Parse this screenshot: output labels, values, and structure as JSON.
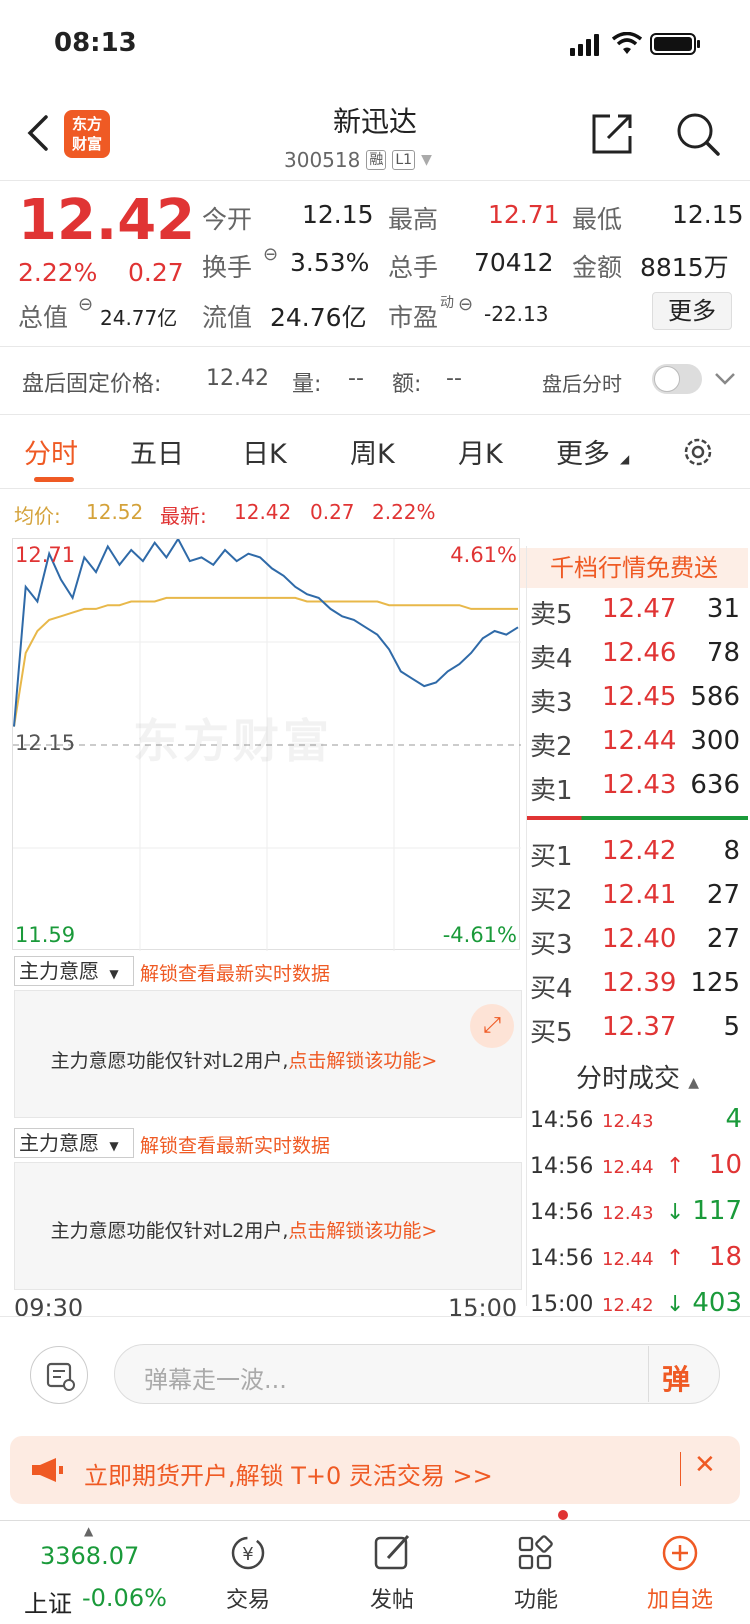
{
  "status": {
    "time": "08:13"
  },
  "header": {
    "logo_line1": "东方",
    "logo_line2": "财富",
    "stock_name": "新迅达",
    "stock_code": "300518",
    "margin_tag": "融",
    "level_tag": "L1"
  },
  "quote": {
    "price": "12.42",
    "change_pct": "2.22%",
    "change": "0.27",
    "open_label": "今开",
    "open": "12.15",
    "high_label": "最高",
    "high": "12.71",
    "low_label": "最低",
    "low": "12.15",
    "turnover_label": "换手",
    "turnover": "3.53%",
    "volume_label": "总手",
    "volume": "70412",
    "amount_label": "金额",
    "amount": "8815万",
    "mktcap_label": "总值",
    "mktcap": "24.77亿",
    "float_label": "流值",
    "float": "24.76亿",
    "pe_label": "市盈",
    "pe_sup": "动",
    "pe": "-22.13",
    "more": "更多"
  },
  "after_hours": {
    "label": "盘后固定价格:",
    "price": "12.42",
    "vol_label": "量:",
    "vol": "--",
    "amt_label": "额:",
    "amt": "--",
    "toggle_label": "盘后分时"
  },
  "tabs": [
    "分时",
    "五日",
    "日K",
    "周K",
    "月K",
    "更多"
  ],
  "chart_header": {
    "avg_label": "均价:",
    "avg": "12.52",
    "latest_label": "最新:",
    "latest": "12.42",
    "change": "0.27",
    "change_pct": "2.22%"
  },
  "chart_data": {
    "type": "line",
    "x_start": "09:30",
    "x_end": "15:00",
    "y_max_label": "12.71",
    "y_mid_label": "12.15",
    "y_min_label": "11.59",
    "pct_max_label": "4.61%",
    "pct_min_label": "-4.61%",
    "ylim": [
      11.59,
      12.71
    ],
    "prev_close": 12.15,
    "watermark": "东方财富",
    "colors": {
      "price": "#2f6aa8",
      "avg": "#e8b84a"
    },
    "series": [
      {
        "values": [
          12.2,
          12.58,
          12.54,
          12.67,
          12.6,
          12.55,
          12.66,
          12.62,
          12.69,
          12.64,
          12.68,
          12.65,
          12.7,
          12.66,
          12.71,
          12.65,
          12.66,
          12.64,
          12.68,
          12.65,
          12.67,
          12.66,
          12.63,
          12.61,
          12.58,
          12.56,
          12.55,
          12.52,
          12.5,
          12.49,
          12.47,
          12.45,
          12.41,
          12.35,
          12.33,
          12.31,
          12.32,
          12.35,
          12.37,
          12.4,
          12.44,
          12.46,
          12.45,
          12.47
        ]
      },
      {
        "values": [
          12.2,
          12.4,
          12.46,
          12.49,
          12.5,
          12.51,
          12.52,
          12.52,
          12.53,
          12.53,
          12.54,
          12.54,
          12.54,
          12.55,
          12.55,
          12.55,
          12.55,
          12.55,
          12.55,
          12.55,
          12.55,
          12.55,
          12.55,
          12.55,
          12.55,
          12.54,
          12.54,
          12.54,
          12.54,
          12.54,
          12.54,
          12.54,
          12.53,
          12.53,
          12.53,
          12.53,
          12.53,
          12.53,
          12.53,
          12.52,
          12.52,
          12.52,
          12.52,
          12.52
        ]
      }
    ]
  },
  "order_book": {
    "title": "千档行情免费送",
    "asks": [
      {
        "label": "卖5",
        "price": "12.47",
        "vol": "31"
      },
      {
        "label": "卖4",
        "price": "12.46",
        "vol": "78"
      },
      {
        "label": "卖3",
        "price": "12.45",
        "vol": "586"
      },
      {
        "label": "卖2",
        "price": "12.44",
        "vol": "300"
      },
      {
        "label": "卖1",
        "price": "12.43",
        "vol": "636"
      }
    ],
    "bids": [
      {
        "label": "买1",
        "price": "12.42",
        "vol": "8"
      },
      {
        "label": "买2",
        "price": "12.41",
        "vol": "27"
      },
      {
        "label": "买3",
        "price": "12.40",
        "vol": "27"
      },
      {
        "label": "买4",
        "price": "12.39",
        "vol": "125"
      },
      {
        "label": "买5",
        "price": "12.37",
        "vol": "5"
      }
    ],
    "trades_title": "分时成交",
    "trades": [
      {
        "time": "14:56",
        "price": "12.43",
        "arrow": "",
        "vol": "4",
        "dir": "green"
      },
      {
        "time": "14:56",
        "price": "12.44",
        "arrow": "↑",
        "vol": "10",
        "dir": "red"
      },
      {
        "time": "14:56",
        "price": "12.43",
        "arrow": "↓",
        "vol": "117",
        "dir": "green"
      },
      {
        "time": "14:56",
        "price": "12.44",
        "arrow": "↑",
        "vol": "18",
        "dir": "red"
      },
      {
        "time": "15:00",
        "price": "12.42",
        "arrow": "↓",
        "vol": "403",
        "dir": "green"
      }
    ]
  },
  "indicators": [
    {
      "select": "主力意愿",
      "link": "解锁查看最新实时数据",
      "msg": "主力意愿功能仅针对L2用户,",
      "msg_link": "点击解锁该功能>"
    },
    {
      "select": "主力意愿",
      "link": "解锁查看最新实时数据",
      "msg": "主力意愿功能仅针对L2用户,",
      "msg_link": "点击解锁该功能>"
    }
  ],
  "comment": {
    "placeholder": "弹幕走一波...",
    "dan": "弹"
  },
  "banner": {
    "text": "立即期货开户,解锁 T+0 灵活交易 >>"
  },
  "bottom_nav": {
    "index_value": "3368.07",
    "index_name": "上证",
    "index_change": "-0.06%",
    "trade": "交易",
    "post": "发帖",
    "function": "功能",
    "add": "加自选"
  }
}
